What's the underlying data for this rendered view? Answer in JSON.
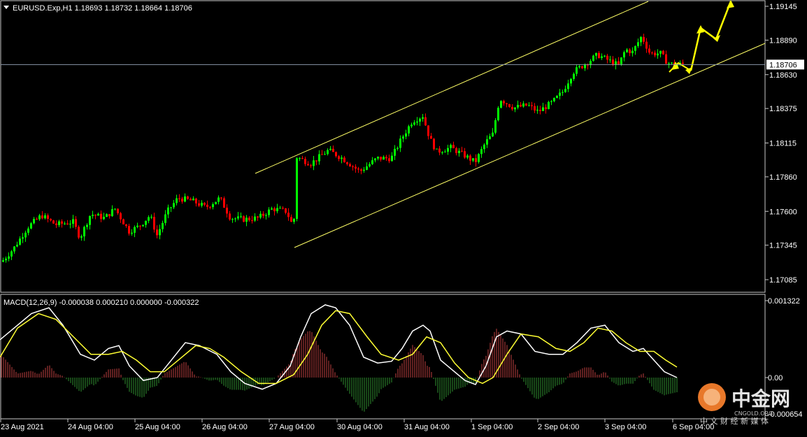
{
  "chart_header": {
    "symbol_line": "EURUSD.Exp,H1  1.18693 1.18732 1.18664 1.18706"
  },
  "macd_header": {
    "label": "MACD(12,26,9) -0.000038 0.000210 0.000000 -0.000322"
  },
  "price_axis": {
    "ticks": [
      "1.19145",
      "1.18890",
      "1.18630",
      "1.18375",
      "1.18115",
      "1.17860",
      "1.17600",
      "1.17345",
      "1.17085"
    ],
    "current_price_label": "1.18706"
  },
  "macd_axis": {
    "ticks": [
      "0.001322",
      "0.00",
      "-0.000654"
    ]
  },
  "time_axis": {
    "labels": [
      "23 Aug 2021",
      "24 Aug 04:00",
      "25 Aug 04:00",
      "26 Aug 04:00",
      "27 Aug 04:00",
      "30 Aug 04:00",
      "31 Aug 04:00",
      "1 Sep 04:00",
      "2 Sep 04:00",
      "3 Sep 04:00",
      "6 Sep 04:00"
    ]
  },
  "watermark": {
    "logo_text": "中金网",
    "sub_text": "CNGOLD.ORG",
    "tagline": "中 文 财 经 新 媒 体"
  },
  "colors": {
    "background": "#000000",
    "bull_candle": "#00ff00",
    "bear_candle": "#ff0000",
    "channel_line": "#ffff66",
    "forecast_arrow": "#ffff00",
    "macd_main": "#ffffff",
    "macd_signal": "#ffff33",
    "hist_positive": "#c04040",
    "hist_negative": "#2f8f2f",
    "current_price_line": "#8896a8",
    "watermark_orange": "#e8782a"
  },
  "chart_data": [
    {
      "type": "candlestick",
      "symbol": "EURUSD.Exp",
      "timeframe": "H1",
      "last_ohlc": {
        "open": 1.18693,
        "high": 1.18732,
        "low": 1.18664,
        "close": 1.18706
      },
      "ylim": [
        1.17,
        1.192
      ],
      "current_price": 1.18706,
      "x": [
        "23 Aug 2021",
        "24 Aug 04:00",
        "25 Aug 04:00",
        "26 Aug 04:00",
        "27 Aug 04:00",
        "30 Aug 04:00",
        "31 Aug 04:00",
        "1 Sep 04:00",
        "2 Sep 04:00",
        "3 Sep 04:00",
        "6 Sep 04:00"
      ],
      "close_approx": [
        1.1722,
        1.1752,
        1.1742,
        1.1762,
        1.1745,
        1.1806,
        1.183,
        1.182,
        1.184,
        1.186,
        1.1875,
        1.1871
      ],
      "high_approx": [
        1.1735,
        1.1763,
        1.176,
        1.178,
        1.1768,
        1.1815,
        1.1845,
        1.186,
        1.185,
        1.1885,
        1.1907,
        1.1882
      ],
      "low_approx": [
        1.171,
        1.1728,
        1.1725,
        1.1745,
        1.1735,
        1.1737,
        1.1798,
        1.1793,
        1.182,
        1.1835,
        1.185,
        1.1866
      ],
      "channel": {
        "upper": [
          {
            "x": "27 Aug 04:00",
            "y": 1.1792
          },
          {
            "x": "3 Sep 04:00",
            "y": 1.1935
          }
        ],
        "lower": [
          {
            "x": "27 Aug 04:00",
            "y": 1.1737
          },
          {
            "x": "6 Sep 04:00",
            "y": 1.1877
          }
        ]
      },
      "forecast_arrows": "upward projection after 6 Sep 04:00"
    },
    {
      "type": "line+histogram",
      "indicator": "MACD(12,26,9)",
      "values": {
        "macd": -3.8e-05,
        "signal": 0.00021,
        "hist": 0.0,
        "other": -0.000322
      },
      "ylim": [
        -0.000654,
        0.001322
      ],
      "macd_line_approx": [
        0.001,
        0.0012,
        0.0008,
        0.0002,
        0.0006,
        -0.0004,
        0.0012,
        0.0006,
        0.0003,
        0.0005,
        -0.0002,
        0.0012,
        0.0008,
        0.0005,
        0.001,
        0.0008,
        0.0004,
        0.0
      ],
      "signal_line_approx": [
        0.0007,
        0.0011,
        0.001,
        0.0006,
        0.0005,
        0.0,
        0.0009,
        0.0009,
        0.0004,
        0.0005,
        0.0,
        0.001,
        0.0009,
        0.0007,
        0.0009,
        0.0008,
        0.0005,
        0.0002
      ]
    }
  ]
}
